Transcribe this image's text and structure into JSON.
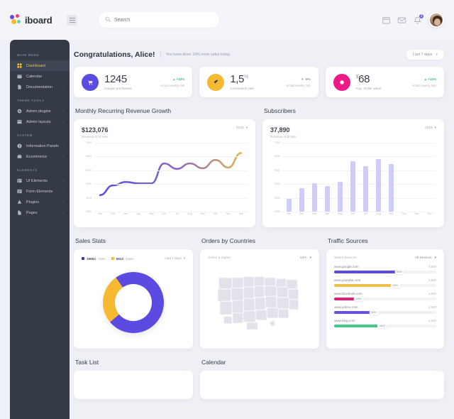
{
  "brand": {
    "name": "iboard"
  },
  "search": {
    "placeholder": "Search",
    "value": ""
  },
  "topbar": {
    "notification_count": "3"
  },
  "sidebar": {
    "sections": [
      {
        "label": "MAIN MENU",
        "items": [
          {
            "label": "Dashboard",
            "icon": "grid-icon",
            "active": true,
            "arrow": ""
          },
          {
            "label": "Calendar",
            "icon": "calendar-icon",
            "active": false,
            "arrow": ""
          },
          {
            "label": "Documentation",
            "icon": "file-icon",
            "active": false,
            "arrow": "›"
          }
        ]
      },
      {
        "label": "THEME TOOLS",
        "items": [
          {
            "label": "Admin plugins",
            "icon": "gear-icon",
            "active": false,
            "arrow": "›"
          },
          {
            "label": "Admin layouts",
            "icon": "layout-icon",
            "active": false,
            "arrow": "›"
          }
        ]
      },
      {
        "label": "SYSTEM",
        "items": [
          {
            "label": "Information Panels",
            "icon": "info-icon",
            "active": false,
            "arrow": "›"
          },
          {
            "label": "Ecommerce",
            "icon": "cart-icon",
            "active": false,
            "arrow": "›"
          }
        ]
      },
      {
        "label": "ELEMENTS",
        "items": [
          {
            "label": "UI Elements",
            "icon": "blocks-icon",
            "active": false,
            "arrow": "›"
          },
          {
            "label": "Form Elements",
            "icon": "form-icon",
            "active": false,
            "arrow": "›"
          },
          {
            "label": "Plugins",
            "icon": "plug-icon",
            "active": false,
            "arrow": "›"
          },
          {
            "label": "Pages",
            "icon": "pages-icon",
            "active": false,
            "arrow": "›"
          }
        ]
      }
    ]
  },
  "greeting": {
    "title": "Congratulations, Alice!",
    "subtitle": "You have done 10% more sales today.",
    "range_label": "Last 7 days"
  },
  "stats": [
    {
      "value": "1245",
      "prefix": "",
      "suffix": "",
      "label": "Unique purchases",
      "delta": "+10%",
      "delta_dir": "up",
      "note": "vs last weekly rate",
      "color": "#5b4be0",
      "icon": "cart-icon"
    },
    {
      "value": "1,5",
      "prefix": "",
      "suffix": "%",
      "label": "Conversion rate",
      "delta": "-9%",
      "delta_dir": "down",
      "note": "vs last weekly rate",
      "color": "#f5b932",
      "icon": "rocket-icon"
    },
    {
      "value": "68",
      "prefix": "$",
      "suffix": "",
      "label": "Avg. Order value",
      "delta": "+15%",
      "delta_dir": "up",
      "note": "vs last weekly rate",
      "color": "#ec1a87",
      "icon": "dollar-icon"
    }
  ],
  "revenue_panel": {
    "title": "Monthly Recurring Revenue Growth",
    "amount": "$123,076",
    "caption": "Revenue of all time",
    "year": "2019"
  },
  "subscribers_panel": {
    "title": "Subscribers",
    "amount": "37,890",
    "caption": "Revenue of all time",
    "year": "2019"
  },
  "sales_panel": {
    "title": "Sales Stats",
    "legend": [
      {
        "value": "19654",
        "name": "Visits",
        "color": "#3d33b5"
      },
      {
        "value": "6913",
        "name": "Sales",
        "color": "#f5b932"
      }
    ],
    "range_label": "Last 7 days"
  },
  "orders_panel": {
    "title": "Orders by Countries",
    "hint": "Select a region",
    "region": "USA"
  },
  "traffic_panel": {
    "title": "Traffic Sources",
    "select_label": "Select Devices",
    "device": "All Devices",
    "rows": [
      {
        "name": "www.google.com",
        "count": "4,540",
        "pct": "63%",
        "width": 63,
        "color": "#5b4be0"
      },
      {
        "name": "www.youtube.com",
        "count": "4,540",
        "pct": "59%",
        "width": 59,
        "color": "#edc04a"
      },
      {
        "name": "www.facebook.com",
        "count": "4,540",
        "pct": "23%",
        "width": 23,
        "color": "#e01f7a"
      },
      {
        "name": "www.yahoo.com",
        "count": "4,540",
        "pct": "38%",
        "width": 38,
        "color": "#6b4fe3"
      },
      {
        "name": "www.bing.com",
        "count": "4,540",
        "pct": "46%",
        "width": 46,
        "color": "#44c78c"
      }
    ]
  },
  "tasks_panel": {
    "title": "Task List"
  },
  "calendar_panel": {
    "title": "Calendar"
  },
  "chart_data": [
    {
      "type": "line",
      "title": "Monthly Recurring Revenue Growth",
      "xlabel": "",
      "ylabel": "",
      "categories": [
        "Jan",
        "Feb",
        "Mar",
        "Apr",
        "May",
        "Jun",
        "Jul",
        "Aug",
        "Sep",
        "Oct",
        "Nov",
        "Dec"
      ],
      "ytick_labels": [
        "7000",
        "6000",
        "5000",
        "4000",
        "3000",
        "2000"
      ],
      "ylim": [
        2000,
        7000
      ],
      "grid": true,
      "legend": "none",
      "series": [
        {
          "name": "Revenue",
          "values": [
            3200,
            3900,
            4150,
            4050,
            4050,
            5500,
            5100,
            5500,
            5150,
            5750,
            5200,
            6250
          ],
          "gradient_from": "#5b4be0",
          "gradient_to": "#e0b34a"
        }
      ]
    },
    {
      "type": "bar",
      "title": "Subscribers",
      "xlabel": "",
      "ylabel": "",
      "categories": [
        "Jan",
        "Feb",
        "Mar",
        "Apr",
        "May",
        "Jun",
        "Jul",
        "Aug",
        "Sep",
        "Oct",
        "Nov",
        "Dec"
      ],
      "values": [
        2950,
        3700,
        4050,
        3850,
        4150,
        5650,
        5300,
        5800,
        5450,
        0,
        0,
        0
      ],
      "ytick_labels": [
        "7000",
        "6000",
        "5000",
        "4000",
        "3000",
        "2000"
      ],
      "ylim": [
        2000,
        7000
      ],
      "grid": true,
      "bar_color": "#cfcdf3"
    },
    {
      "type": "pie",
      "title": "Sales Stats",
      "labels": [
        "Visits",
        "Sales"
      ],
      "values": [
        19654,
        6913
      ],
      "colors": [
        "#5b4be0",
        "#f5b932"
      ],
      "donut": true,
      "legend": "top-left"
    },
    {
      "type": "bar",
      "title": "Traffic Sources",
      "orientation": "horizontal",
      "categories": [
        "www.google.com",
        "www.youtube.com",
        "www.facebook.com",
        "www.yahoo.com",
        "www.bing.com"
      ],
      "values": [
        63,
        59,
        23,
        38,
        46
      ],
      "value_labels": [
        "63%",
        "59%",
        "23%",
        "38%",
        "46%"
      ],
      "counts": [
        "4,540",
        "4,540",
        "4,540",
        "4,540",
        "4,540"
      ],
      "colors": [
        "#5b4be0",
        "#edc04a",
        "#e01f7a",
        "#6b4fe3",
        "#44c78c"
      ],
      "xlim": [
        0,
        100
      ]
    }
  ]
}
